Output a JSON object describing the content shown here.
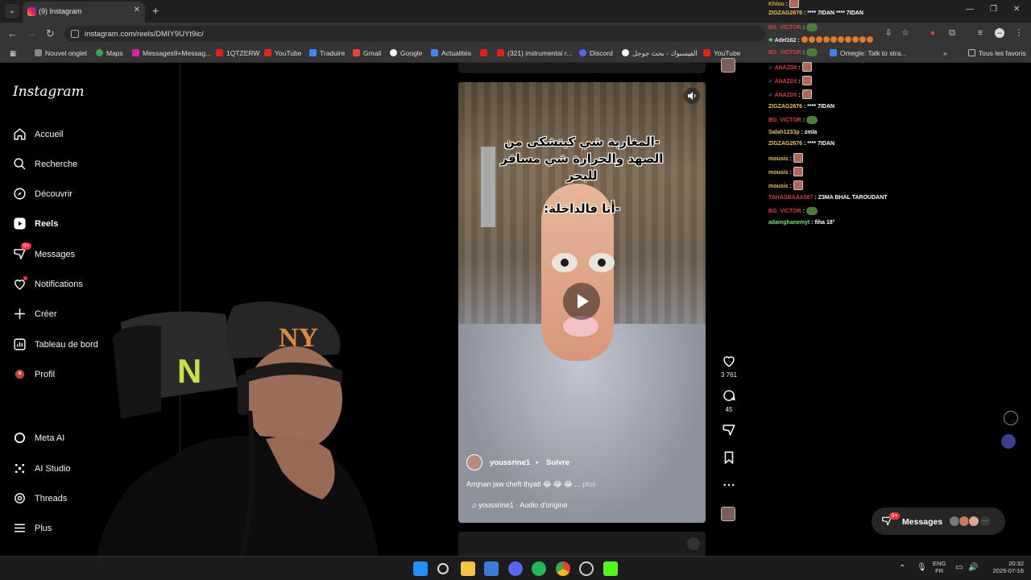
{
  "browser": {
    "tab_count_title": "(9) Instagram",
    "url": "instagram.com/reels/DMIY9UYt9ic/",
    "bookmarks": [
      "Nouvel onglet",
      "Maps",
      "Messages9+Messag...",
      "1QTZERW",
      "YouTube",
      "Traduire",
      "Gmail",
      "Google",
      "Actualités",
      "",
      "(321) instrumental r...",
      "Discord",
      "الفيسبوك - بحث جوجل",
      "YouTube",
      "Omegle: Talk to stra..."
    ],
    "bookmarks_overflow": "»",
    "all_bookmarks": "Tous les favoris"
  },
  "instagram": {
    "logo": "Instagram",
    "nav": [
      {
        "label": "Accueil",
        "icon": "home-icon"
      },
      {
        "label": "Recherche",
        "icon": "search-icon"
      },
      {
        "label": "Découvrir",
        "icon": "compass-icon"
      },
      {
        "label": "Reels",
        "icon": "reels-icon"
      },
      {
        "label": "Messages",
        "icon": "messenger-icon",
        "badge": "9+"
      },
      {
        "label": "Notifications",
        "icon": "heart-icon"
      },
      {
        "label": "Créer",
        "icon": "plus-icon"
      },
      {
        "label": "Tableau de bord",
        "icon": "dashboard-icon"
      },
      {
        "label": "Profil",
        "icon": "avatar-icon"
      }
    ],
    "nav_bottom": [
      {
        "label": "Meta AI",
        "icon": "meta-ai-icon"
      },
      {
        "label": "AI Studio",
        "icon": "ai-studio-icon"
      },
      {
        "label": "Threads",
        "icon": "threads-icon"
      },
      {
        "label": "Plus",
        "icon": "menu-icon"
      }
    ],
    "reel": {
      "caption_line1": "-المغاربة شي كيتشكى من",
      "caption_line2": "الصهد والحرارة شي مسافر",
      "caption_line3": "للبحر",
      "caption_line4": "-أنا فالداخلة:",
      "author": "youssrine1",
      "separator": "•",
      "follow": "Suivre",
      "description": "Amjnan jaw cheft thyati 😂 😂 😂 ...",
      "more": "plus",
      "audio": "youssrine1 · Audio d'origine",
      "likes": "3 761",
      "comments": "45"
    },
    "messages_pill": {
      "label": "Messages",
      "badge": "9+"
    }
  },
  "chat": [
    {
      "user": "Khlou",
      "color": "#e0a030",
      "text": "",
      "emote": "face"
    },
    {
      "user": "ZIGZAG2676",
      "color": "#e6c25a",
      "text": "**** 7IDAN **** 7IDAN"
    },
    {
      "user": "BG_VICTOR",
      "color": "#d54040",
      "text": "",
      "emote": "green"
    },
    {
      "user": "Adel162",
      "color": "#e6e6e6",
      "text": "",
      "emote": "circles"
    },
    {
      "user": "BG_VICTOR",
      "color": "#d54040",
      "text": "",
      "emote": "green"
    },
    {
      "user": "ANAZ0X",
      "color": "#d54040",
      "text": "",
      "emote": "face"
    },
    {
      "user": "ANAZ0X",
      "color": "#d54040",
      "text": "",
      "emote": "face"
    },
    {
      "user": "ANAZ0X",
      "color": "#d54040",
      "text": "",
      "emote": "face"
    },
    {
      "user": "ZIGZAG2676",
      "color": "#e6c25a",
      "text": "**** 7IDAN"
    },
    {
      "user": "BG_VICTOR",
      "color": "#d54040",
      "text": "",
      "emote": "green"
    },
    {
      "user": "Salah1233p",
      "color": "#e6c25a",
      "text": "zmla"
    },
    {
      "user": "ZIGZAG2676",
      "color": "#e6c25a",
      "text": "**** 7IDAN"
    },
    {
      "user": "mousis",
      "color": "#e6c25a",
      "text": "",
      "emote": "face"
    },
    {
      "user": "mousis",
      "color": "#e6c25a",
      "text": "",
      "emote": "face"
    },
    {
      "user": "mousis",
      "color": "#e6c25a",
      "text": "",
      "emote": "face"
    },
    {
      "user": "TAHASBAAA567",
      "color": "#d54040",
      "text": "Z3MA BHAL TAROUDANT"
    },
    {
      "user": "BG_VICTOR",
      "color": "#d54040",
      "text": "",
      "emote": "green"
    },
    {
      "user": "adamghanemyt",
      "color": "#7be07b",
      "text": "fiha 18°"
    }
  ],
  "taskbar": {
    "lang_top": "ENG",
    "lang_bottom": "FR",
    "time": "20:32",
    "date": "2025-07-16"
  },
  "colors": {
    "accent_red": "#ff3040",
    "ig_bg": "#000000",
    "chrome_bg": "#353535"
  }
}
